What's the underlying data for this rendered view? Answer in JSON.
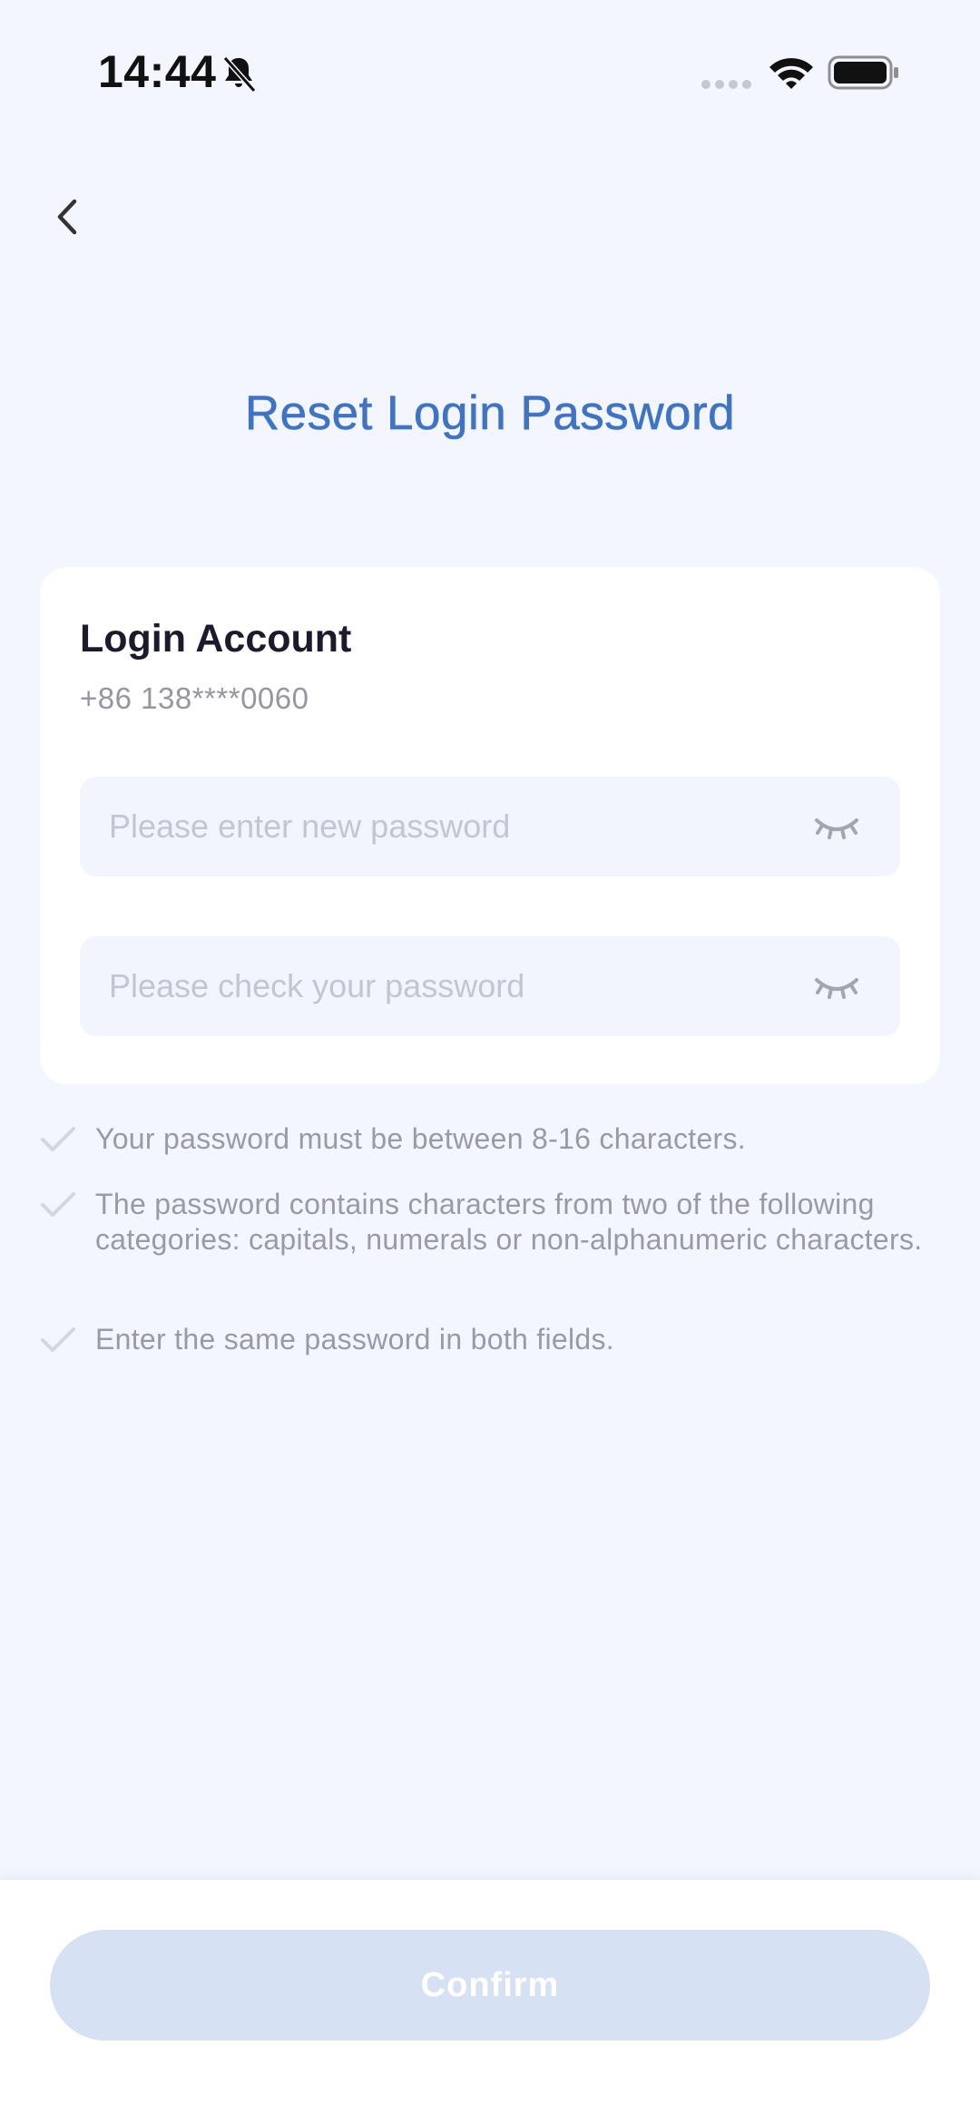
{
  "status_bar": {
    "time": "14:44",
    "icons": [
      "bell-slash-icon",
      "signal-dots-icon",
      "wifi-icon",
      "battery-icon"
    ]
  },
  "header": {
    "back_icon": "chevron-left-icon",
    "title": "Reset Login Password"
  },
  "account_card": {
    "title": "Login Account",
    "account": "+86 138****0060",
    "new_password": {
      "placeholder": "Please enter new password",
      "value": "",
      "icon": "eye-closed-icon"
    },
    "confirm_password": {
      "placeholder": "Please check your password",
      "value": "",
      "icon": "eye-closed-icon"
    }
  },
  "rules": [
    {
      "icon": "check-icon",
      "text": "Your password must be between 8-16 characters."
    },
    {
      "icon": "check-icon",
      "text": "The password contains characters from two of the following categories: capitals, numerals or non-alphanumeric characters."
    },
    {
      "icon": "check-icon",
      "text": "Enter the same password in both fields."
    }
  ],
  "footer": {
    "confirm_label": "Confirm"
  },
  "colors": {
    "background": "#f3f6fe",
    "accent": "#3f74c4",
    "button_disabled": "#d6e1f3",
    "check_gray": "#d3d6e2"
  }
}
